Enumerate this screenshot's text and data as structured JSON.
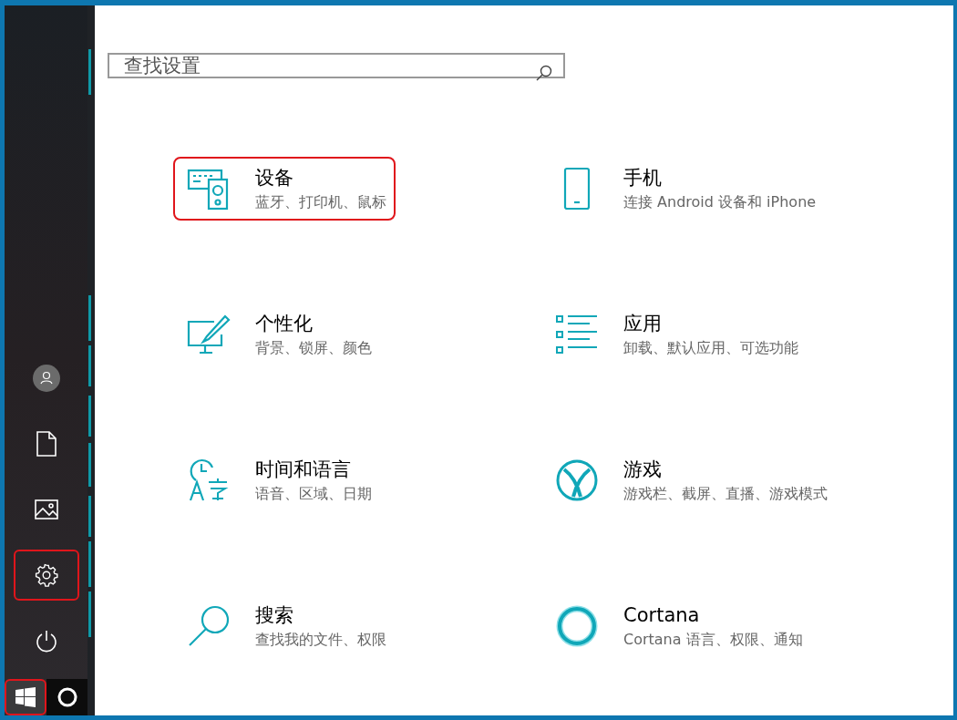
{
  "sidebar": {
    "items": [
      {
        "kind": "user",
        "highlighted": false
      },
      {
        "kind": "document",
        "highlighted": false
      },
      {
        "kind": "pictures",
        "highlighted": false
      },
      {
        "kind": "settings",
        "highlighted": true
      },
      {
        "kind": "power",
        "highlighted": false
      }
    ]
  },
  "taskbar": {
    "start_highlighted": true
  },
  "search": {
    "placeholder": "查找设置"
  },
  "categories": [
    {
      "kind": "devices",
      "title": "设备",
      "subtitle": "蓝牙、打印机、鼠标",
      "highlighted": true
    },
    {
      "kind": "phone",
      "title": "手机",
      "subtitle": "连接 Android 设备和 iPhone",
      "highlighted": false
    },
    {
      "kind": "personalization",
      "title": "个性化",
      "subtitle": "背景、锁屏、颜色",
      "highlighted": false
    },
    {
      "kind": "apps",
      "title": "应用",
      "subtitle": "卸载、默认应用、可选功能",
      "highlighted": false
    },
    {
      "kind": "time",
      "title": "时间和语言",
      "subtitle": "语音、区域、日期",
      "highlighted": false
    },
    {
      "kind": "gaming",
      "title": "游戏",
      "subtitle": "游戏栏、截屏、直播、游戏模式",
      "highlighted": false
    },
    {
      "kind": "search",
      "title": "搜索",
      "subtitle": "查找我的文件、权限",
      "highlighted": false
    },
    {
      "kind": "cortana",
      "title": "Cortana",
      "subtitle": "Cortana 语言、权限、通知",
      "highlighted": false
    }
  ]
}
